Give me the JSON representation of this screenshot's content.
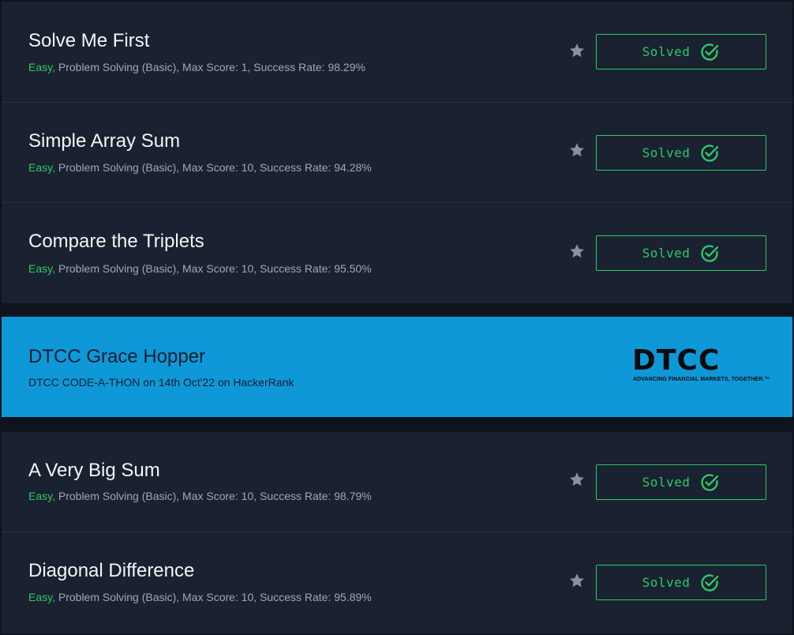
{
  "colors": {
    "page_bg": "#0e141e",
    "card_bg": "#1a2130",
    "accent_green": "#2ec866",
    "banner_blue": "#0e98d8"
  },
  "challenges": [
    {
      "title": "Solve Me First",
      "difficulty": "Easy,",
      "details": " Problem Solving (Basic), Max Score: 1, Success Rate: 98.29%",
      "status": "Solved",
      "icon": "star-icon"
    },
    {
      "title": "Simple Array Sum",
      "difficulty": "Easy,",
      "details": " Problem Solving (Basic), Max Score: 10, Success Rate: 94.28%",
      "status": "Solved",
      "icon": "star-icon"
    },
    {
      "title": "Compare the Triplets",
      "difficulty": "Easy,",
      "details": " Problem Solving (Basic), Max Score: 10, Success Rate: 95.50%",
      "status": "Solved",
      "icon": "star-icon"
    },
    {
      "title": "A Very Big Sum",
      "difficulty": "Easy,",
      "details": " Problem Solving (Basic), Max Score: 10, Success Rate: 98.79%",
      "status": "Solved",
      "icon": "star-icon"
    },
    {
      "title": "Diagonal Difference",
      "difficulty": "Easy,",
      "details": " Problem Solving (Basic), Max Score: 10, Success Rate: 95.89%",
      "status": "Solved",
      "icon": "star-icon"
    }
  ],
  "promo": {
    "title": "DTCC Grace Hopper",
    "subtitle": "DTCC CODE-A-THON on 14th Oct'22 on HackerRank",
    "logo_text": "DTCC",
    "logo_tagline": "ADVANCING FINANCIAL MARKETS. TOGETHER.™"
  }
}
